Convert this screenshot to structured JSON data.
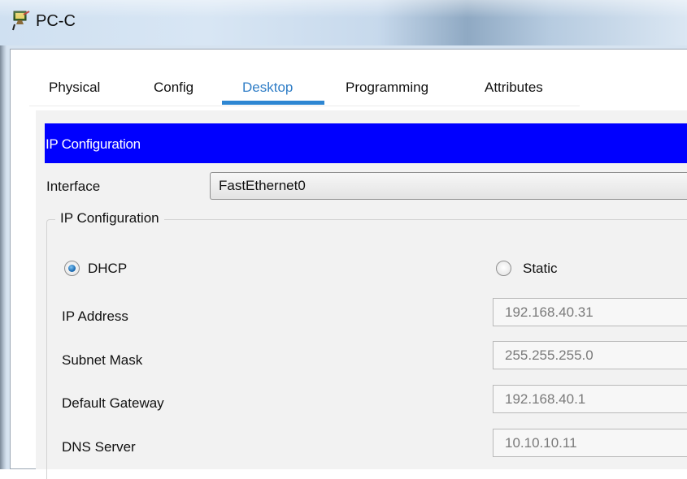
{
  "window": {
    "title": "PC-C",
    "icon": "pc-device-icon"
  },
  "tabs": [
    {
      "label": "Physical",
      "active": false
    },
    {
      "label": "Config",
      "active": false
    },
    {
      "label": "Desktop",
      "active": true
    },
    {
      "label": "Programming",
      "active": false
    },
    {
      "label": "Attributes",
      "active": false
    }
  ],
  "section": {
    "header": "IP Configuration"
  },
  "interface": {
    "label": "Interface",
    "value": "FastEthernet0"
  },
  "ip_config": {
    "group_title": "IP Configuration",
    "dhcp_label": "DHCP",
    "static_label": "Static",
    "mode": "DHCP",
    "fields": [
      {
        "label": "IP Address",
        "value": "192.168.40.31"
      },
      {
        "label": "Subnet Mask",
        "value": "255.255.255.0"
      },
      {
        "label": "Default Gateway",
        "value": "192.168.40.1"
      },
      {
        "label": "DNS Server",
        "value": "10.10.10.11"
      }
    ]
  },
  "colors": {
    "header_bg": "#0000ff",
    "active_tab": "#2f7dc6",
    "panel_bg": "#f2f2f2"
  }
}
